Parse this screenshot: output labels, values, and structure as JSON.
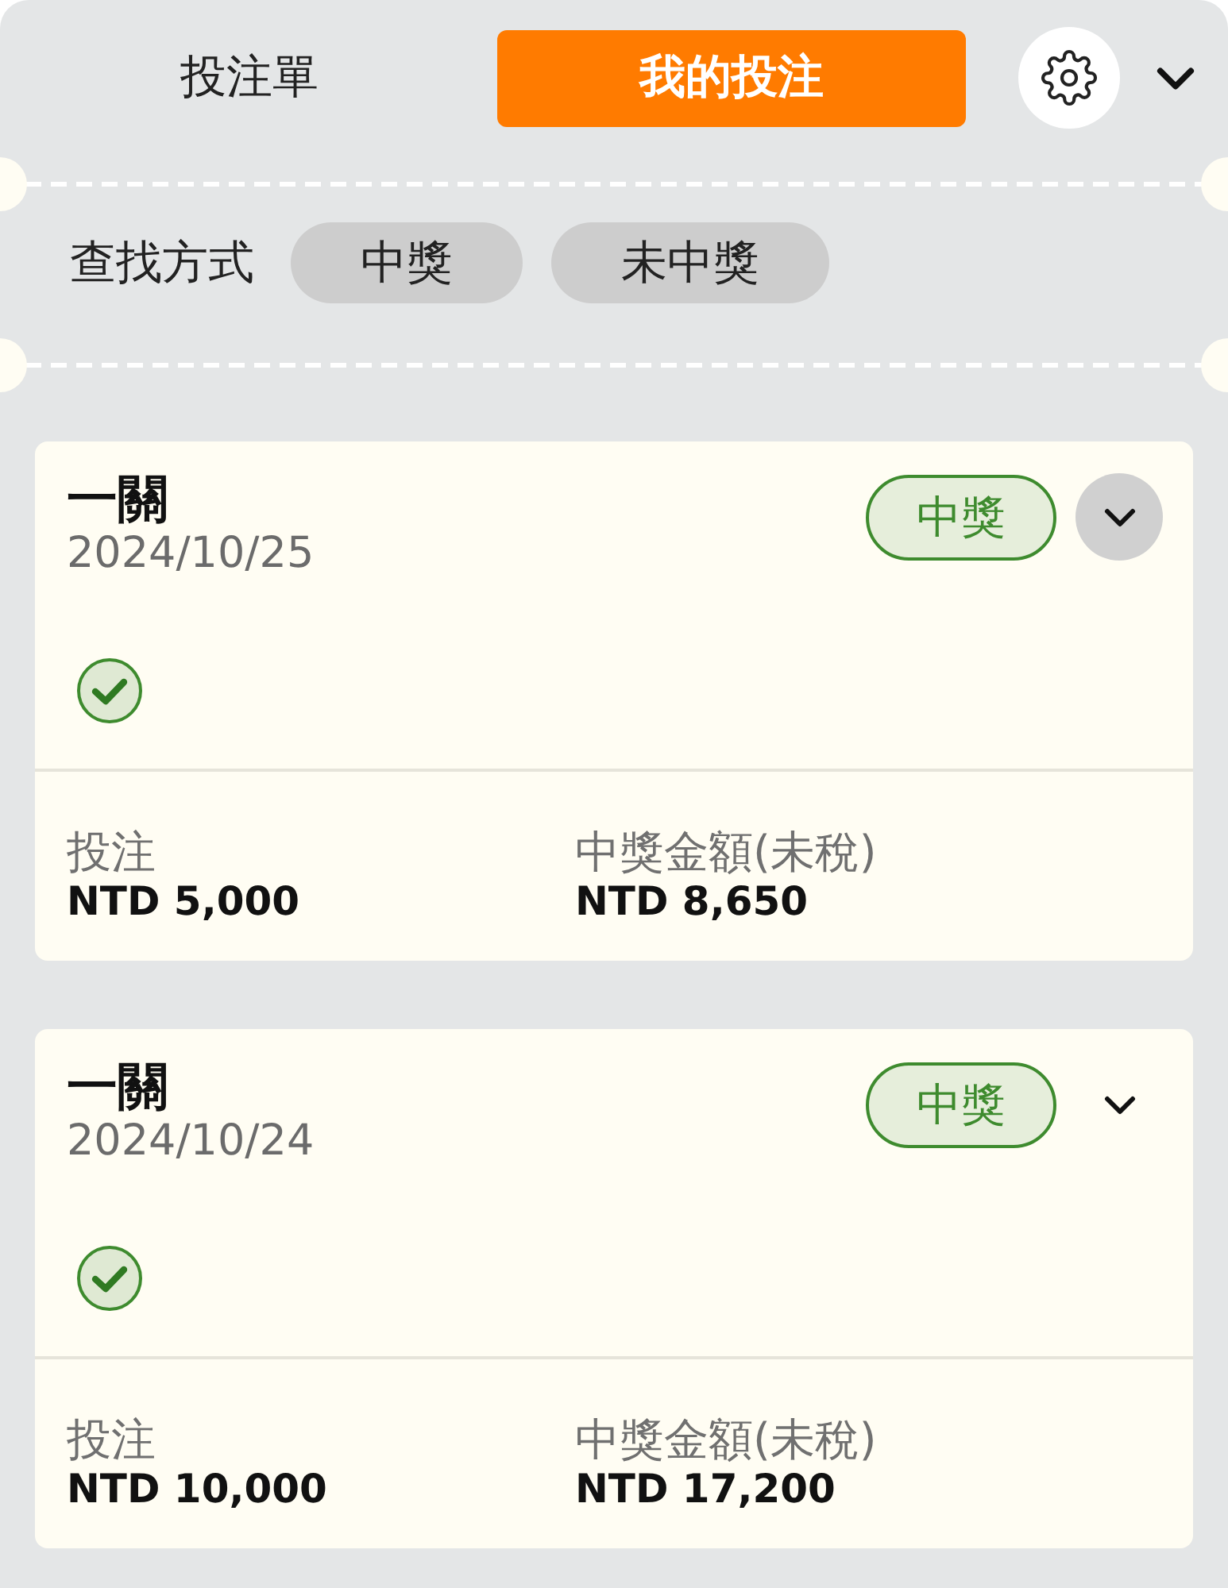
{
  "header": {
    "tabs": [
      {
        "label": "投注單",
        "selected": false
      },
      {
        "label": "我的投注",
        "selected": true
      }
    ]
  },
  "filter": {
    "label": "查找方式",
    "options": [
      {
        "label": "中獎",
        "selected": false
      },
      {
        "label": "未中獎",
        "selected": false
      }
    ]
  },
  "bets": [
    {
      "title": "一關",
      "date": "2024/10/25",
      "badge": {
        "label": "中獎",
        "kind": "won"
      },
      "pressed": true,
      "expanded": false,
      "legs": [
        {
          "won": true
        }
      ],
      "amounts": [
        {
          "label": "投注",
          "value": "NTD 5,000"
        },
        {
          "label": "中獎金額(未稅)",
          "value": "NTD 8,650"
        }
      ]
    },
    {
      "title": "一關",
      "date": "2024/10/24",
      "badge": {
        "label": "中獎",
        "kind": "won"
      },
      "pressed": false,
      "expanded": false,
      "legs": [
        {
          "won": true
        }
      ],
      "amounts": [
        {
          "label": "投注",
          "value": "NTD 10,000"
        },
        {
          "label": "中獎金額(未稅)",
          "value": "NTD 17,200"
        }
      ]
    }
  ]
}
